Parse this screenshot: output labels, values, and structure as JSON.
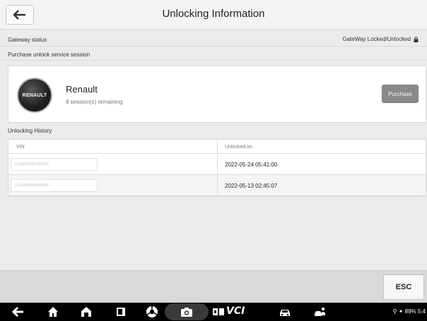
{
  "header": {
    "title": "Unlocking Information"
  },
  "gateway": {
    "label": "Gateway status",
    "value": "GateWay Locked/Unlocked"
  },
  "purchase": {
    "section_label": "Purchase unlock service session",
    "brand_name": "Renault",
    "logo_text": "RENAULT",
    "sessions": "8 session(s) remaining",
    "button_label": "Purchase"
  },
  "history": {
    "label": "Unlocking History",
    "columns": {
      "vin": "VIN",
      "unlocked_on": "Unlocked on"
    },
    "rows": [
      {
        "vin": "LSGEMERML000981",
        "unlocked_on": "2022-05-24 05:41:00"
      },
      {
        "vin": "LSGEMERML000981",
        "unlocked_on": "2022-05-13 02:45:07"
      }
    ]
  },
  "footer": {
    "esc_label": "ESC"
  },
  "navbar": {
    "vci_label": "VCI",
    "status": "89% 5:4"
  },
  "colors": {
    "purchase_button": "#8a8a8a",
    "navbar": "#000000"
  }
}
